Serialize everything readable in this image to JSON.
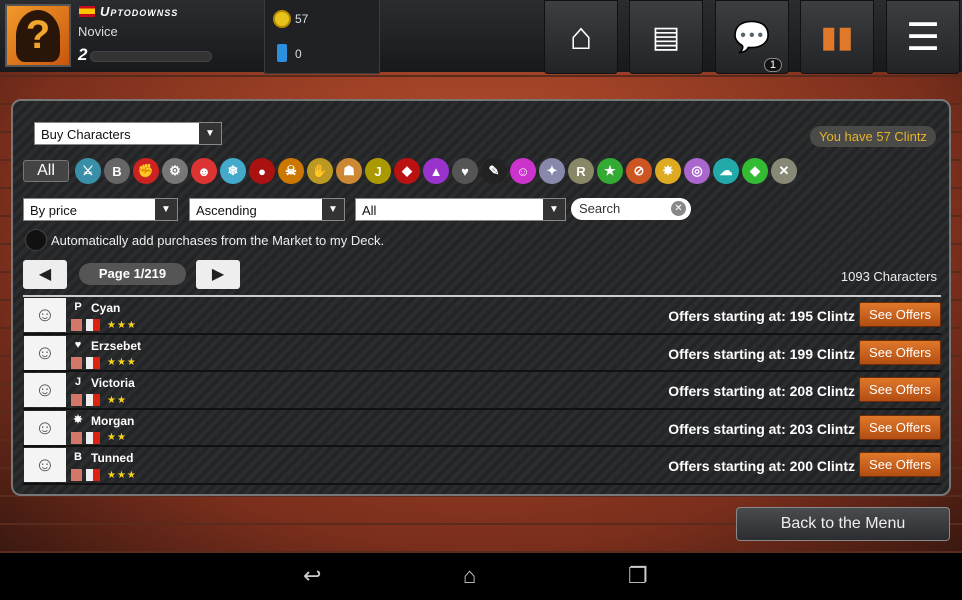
{
  "profile": {
    "username": "Uptodownss",
    "rank": "Novice",
    "level": "2",
    "xp_progress": 0
  },
  "resources": {
    "clintz": "57",
    "credits": "0"
  },
  "nav": {
    "messages_badge": "1"
  },
  "filters": {
    "mode": "Buy Characters",
    "all_label": "All",
    "sort": "By price",
    "order": "Ascending",
    "rarity": "All",
    "search_placeholder": "Search"
  },
  "balance": "You have 57 Clintz",
  "auto_add_label": "Automatically add purchases from the Market to my Deck.",
  "auto_add_checked": false,
  "pagination": {
    "page": "Page 1/219",
    "total": "1093 Characters"
  },
  "clans": [
    {
      "g": "⚔",
      "c": "#3a8fa8"
    },
    {
      "g": "B",
      "c": "#666"
    },
    {
      "g": "✊",
      "c": "#c22"
    },
    {
      "g": "⚙",
      "c": "#777"
    },
    {
      "g": "☻",
      "c": "#d33"
    },
    {
      "g": "❄",
      "c": "#4ac"
    },
    {
      "g": "●",
      "c": "#a11"
    },
    {
      "g": "☠",
      "c": "#c70"
    },
    {
      "g": "✋",
      "c": "#b92"
    },
    {
      "g": "☗",
      "c": "#c83"
    },
    {
      "g": "J",
      "c": "#a90"
    },
    {
      "g": "◆",
      "c": "#b11"
    },
    {
      "g": "▲",
      "c": "#93c"
    },
    {
      "g": "♥",
      "c": "#555"
    },
    {
      "g": "✎",
      "c": "#222"
    },
    {
      "g": "☺",
      "c": "#c3c"
    },
    {
      "g": "✦",
      "c": "#88a"
    },
    {
      "g": "R",
      "c": "#886"
    },
    {
      "g": "★",
      "c": "#3a3"
    },
    {
      "g": "⊘",
      "c": "#c52"
    },
    {
      "g": "✸",
      "c": "#da2"
    },
    {
      "g": "◎",
      "c": "#a6c"
    },
    {
      "g": "☁",
      "c": "#2aa"
    },
    {
      "g": "◆",
      "c": "#3b3"
    },
    {
      "g": "✕",
      "c": "#887"
    }
  ],
  "characters": [
    {
      "name": "Cyan",
      "clan_icon": "P",
      "stars": "★★★",
      "offer": "Offers starting at: 195 Clintz",
      "button": "See Offers"
    },
    {
      "name": "Erzsebet",
      "clan_icon": "♥",
      "stars": "★★★",
      "offer": "Offers starting at: 199 Clintz",
      "button": "See Offers"
    },
    {
      "name": "Victoria",
      "clan_icon": "J",
      "stars": "★★",
      "offer": "Offers starting at: 208 Clintz",
      "button": "See Offers"
    },
    {
      "name": "Morgan",
      "clan_icon": "✸",
      "stars": "★★",
      "offer": "Offers starting at: 203 Clintz",
      "button": "See Offers"
    },
    {
      "name": "Tunned",
      "clan_icon": "B",
      "stars": "★★★",
      "offer": "Offers starting at: 200 Clintz",
      "button": "See Offers"
    }
  ],
  "back_label": "Back to the Menu"
}
